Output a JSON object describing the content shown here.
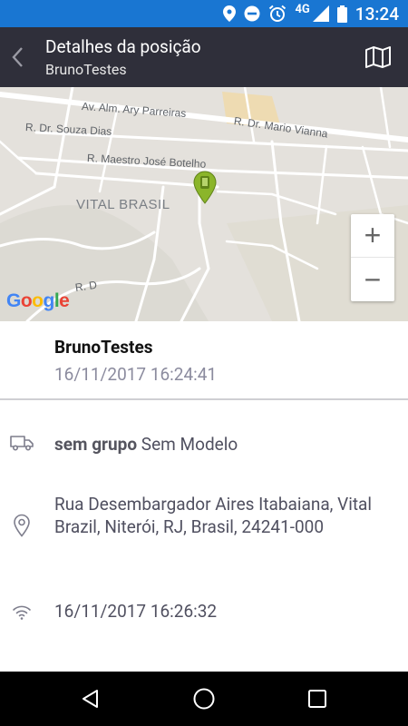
{
  "status_bar": {
    "network": "4G",
    "time": "13:24",
    "background": "#1976d2"
  },
  "app_bar": {
    "title": "Detalhes da posição",
    "subtitle": "BrunoTestes",
    "background": "#2f2f3a"
  },
  "map": {
    "streets": [
      "Av. Alm. Ary Parreiras",
      "R. Dr. Mario Vianna",
      "R. Dr. Souza Dias",
      "R. Maestro José Botelho",
      "R. D"
    ],
    "district": "VITAL BRASIL",
    "zoom_in_label": "+",
    "zoom_out_label": "−",
    "logo_letters": [
      "G",
      "o",
      "o",
      "g",
      "l",
      "e"
    ],
    "marker_color": "#8bb52a"
  },
  "vehicle": {
    "name": "BrunoTestes",
    "position_time": "16/11/2017 16:24:41"
  },
  "details": {
    "group": "sem grupo",
    "model": "Sem Modelo",
    "address": "Rua Desembargador Aires Itabaiana, Vital Brazil, Niterói, RJ, Brasil, 24241-000",
    "last_update": "16/11/2017 16:26:32"
  },
  "icons": {
    "status": [
      "location-icon",
      "do-not-disturb-icon",
      "alarm-icon",
      "signal-icon",
      "battery-icon"
    ],
    "rows": [
      "truck-icon",
      "pin-icon",
      "wifi-icon"
    ],
    "nav": [
      "back-triangle-icon",
      "home-circle-icon",
      "recents-square-icon"
    ]
  }
}
